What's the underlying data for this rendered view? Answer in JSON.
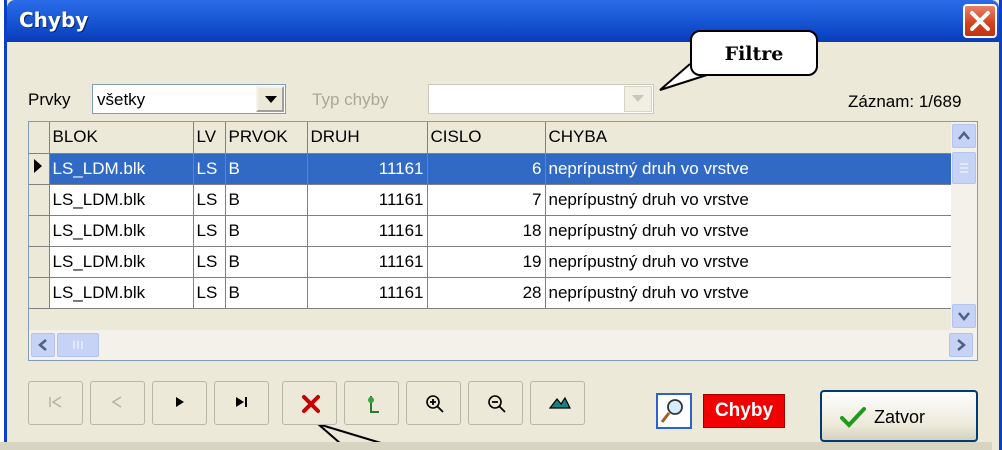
{
  "window": {
    "title": "Chyby",
    "close_icon": "close-icon"
  },
  "filters": {
    "prvky_label": "Prvky",
    "prvky_value": "všetky",
    "typ_label": "Typ chyby",
    "typ_value": ""
  },
  "callout": {
    "text": "Filtre"
  },
  "record": {
    "text": "Záznam: 1/689"
  },
  "grid": {
    "columns": [
      "BLOK",
      "LV",
      "PRVOK",
      "DRUH",
      "CISLO",
      "CHYBA"
    ],
    "rows": [
      [
        "LS_LDM.blk",
        "LS",
        "B",
        "11161",
        "6",
        "neprípustný druh vo vrstve"
      ],
      [
        "LS_LDM.blk",
        "LS",
        "B",
        "11161",
        "7",
        "neprípustný druh vo vrstve"
      ],
      [
        "LS_LDM.blk",
        "LS",
        "B",
        "11161",
        "18",
        "neprípustný druh vo vrstve"
      ],
      [
        "LS_LDM.blk",
        "LS",
        "B",
        "11161",
        "19",
        "neprípustný druh vo vrstve"
      ],
      [
        "LS_LDM.blk",
        "LS",
        "B",
        "11161",
        "28",
        "neprípustný druh vo vrstve"
      ]
    ],
    "selected_row": 0
  },
  "toolbar": {
    "buttons": [
      "first-record-icon",
      "prev-record-icon",
      "next-record-icon",
      "last-record-icon",
      "delete-icon",
      "locate-icon",
      "zoom-in-icon",
      "zoom-out-icon",
      "terrain-icon"
    ]
  },
  "chyby_badge": "Chyby",
  "close_button": "Zatvor",
  "colors": {
    "title_bar": "#0d46c6",
    "selection": "#316ac5",
    "badge": "#f00000"
  }
}
